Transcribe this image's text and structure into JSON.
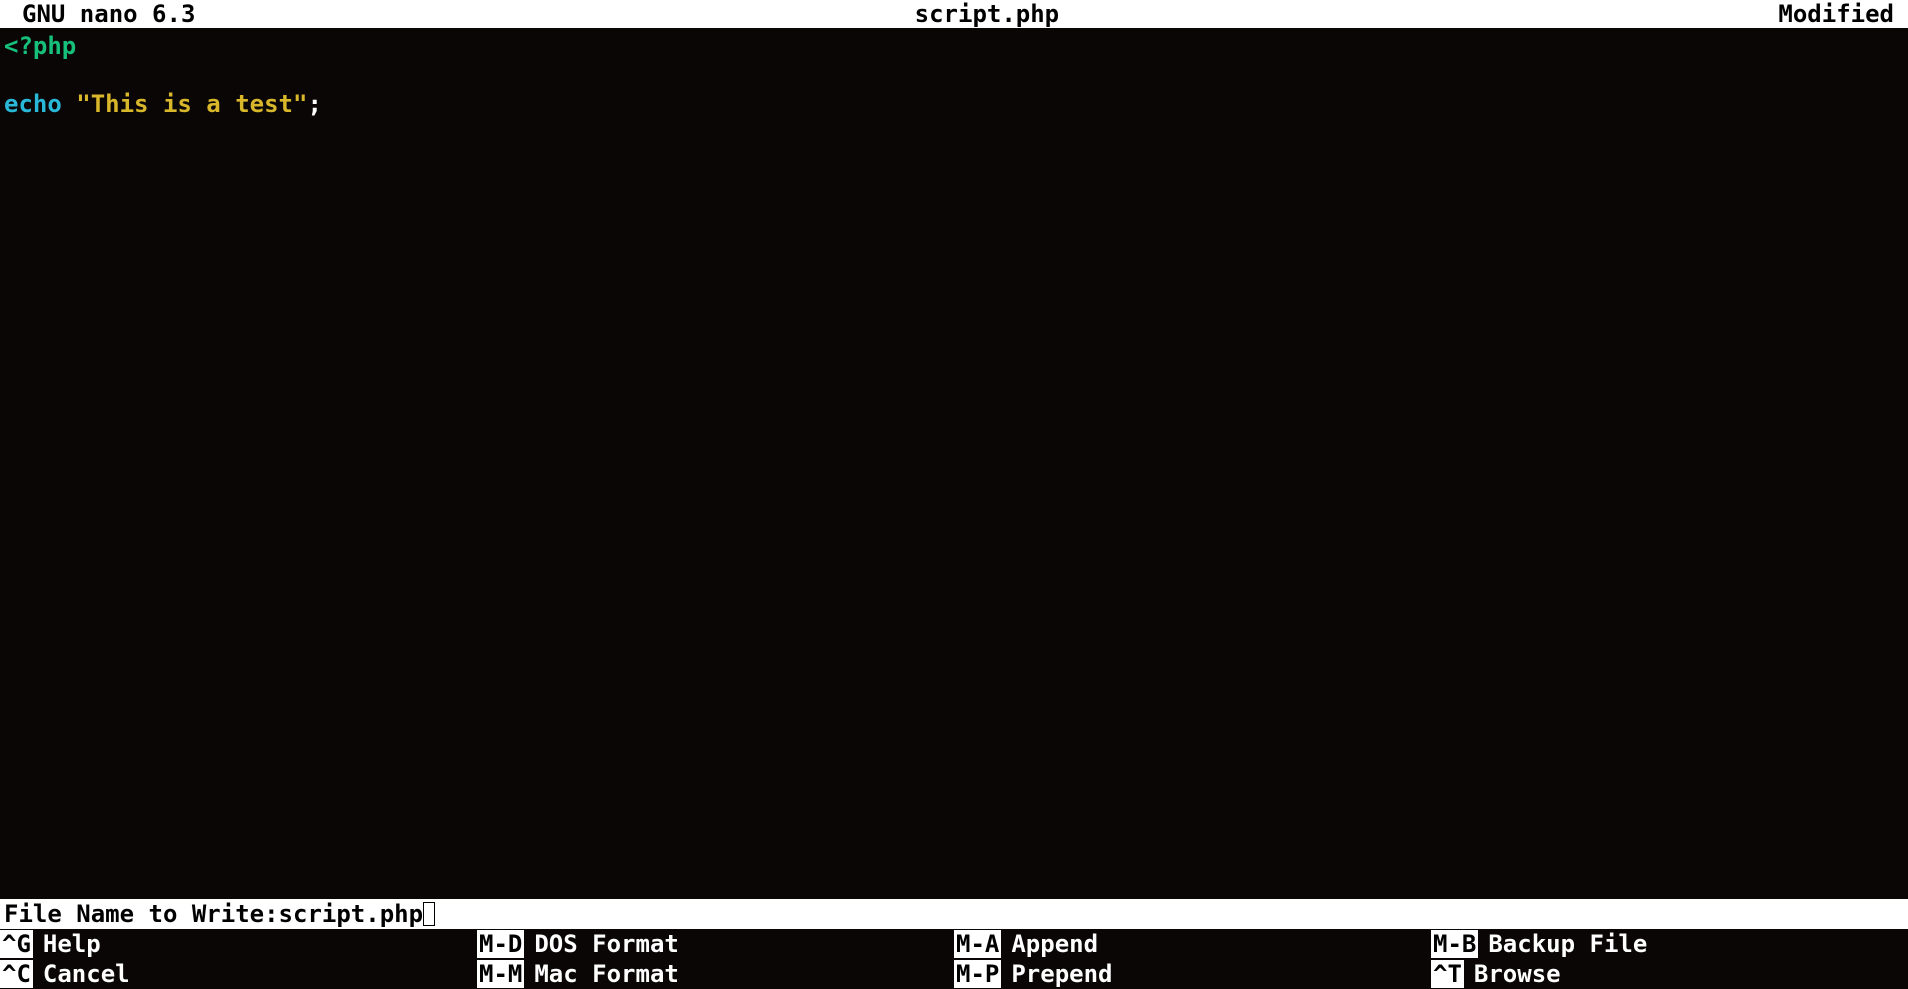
{
  "titlebar": {
    "app": "GNU nano 6.3",
    "filename": "script.php",
    "status": "Modified"
  },
  "code": {
    "line1": "<?php",
    "line3_echo": "echo",
    "line3_space": " ",
    "line3_str": "\"This is a test\"",
    "line3_semi": ";"
  },
  "prompt": {
    "label": "File Name to Write: ",
    "value": "script.php"
  },
  "shortcuts": [
    {
      "key": "^G",
      "label": "Help"
    },
    {
      "key": "M-D",
      "label": "DOS Format"
    },
    {
      "key": "M-A",
      "label": "Append"
    },
    {
      "key": "M-B",
      "label": "Backup File"
    },
    {
      "key": "^C",
      "label": "Cancel"
    },
    {
      "key": "M-M",
      "label": "Mac Format"
    },
    {
      "key": "M-P",
      "label": "Prepend"
    },
    {
      "key": "^T",
      "label": "Browse"
    }
  ]
}
